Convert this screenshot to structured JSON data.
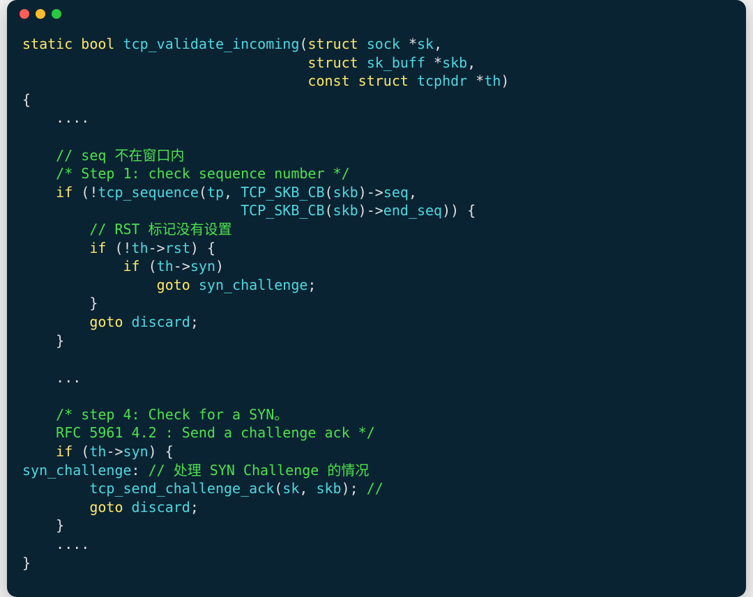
{
  "colors": {
    "background": "#0a2332",
    "keyword": "#ffe86b",
    "identifier": "#4fd8e0",
    "comment": "#4ee04e",
    "punct": "#e0e0e0",
    "traffic_red": "#ff5e57",
    "traffic_yellow": "#febc2e",
    "traffic_green": "#28c840"
  },
  "titlebar": {
    "buttons": [
      "close",
      "minimize",
      "zoom"
    ]
  },
  "code": {
    "lines": [
      [
        [
          "kw",
          "static"
        ],
        [
          "pn",
          " "
        ],
        [
          "kw",
          "bool"
        ],
        [
          "pn",
          " "
        ],
        [
          "fn",
          "tcp_validate_incoming"
        ],
        [
          "pn",
          "("
        ],
        [
          "kw",
          "struct"
        ],
        [
          "pn",
          " "
        ],
        [
          "fn",
          "sock"
        ],
        [
          "pn",
          " *"
        ],
        [
          "fn",
          "sk"
        ],
        [
          "pn",
          ","
        ]
      ],
      [
        [
          "pn",
          "                                  "
        ],
        [
          "kw",
          "struct"
        ],
        [
          "pn",
          " "
        ],
        [
          "fn",
          "sk_buff"
        ],
        [
          "pn",
          " *"
        ],
        [
          "fn",
          "skb"
        ],
        [
          "pn",
          ","
        ]
      ],
      [
        [
          "pn",
          "                                  "
        ],
        [
          "kw",
          "const"
        ],
        [
          "pn",
          " "
        ],
        [
          "kw",
          "struct"
        ],
        [
          "pn",
          " "
        ],
        [
          "fn",
          "tcphdr"
        ],
        [
          "pn",
          " *"
        ],
        [
          "fn",
          "th"
        ],
        [
          "pn",
          ")"
        ]
      ],
      [
        [
          "pn",
          "{"
        ]
      ],
      [
        [
          "pn",
          "    ...."
        ]
      ],
      [
        [
          "pn",
          ""
        ]
      ],
      [
        [
          "pn",
          "    "
        ],
        [
          "cm",
          "// seq 不在窗口内"
        ]
      ],
      [
        [
          "pn",
          "    "
        ],
        [
          "cm",
          "/* Step 1: check sequence number */"
        ]
      ],
      [
        [
          "pn",
          "    "
        ],
        [
          "kw",
          "if"
        ],
        [
          "pn",
          " (!"
        ],
        [
          "fn",
          "tcp_sequence"
        ],
        [
          "pn",
          "("
        ],
        [
          "fn",
          "tp"
        ],
        [
          "pn",
          ", "
        ],
        [
          "fn",
          "TCP_SKB_CB"
        ],
        [
          "pn",
          "("
        ],
        [
          "fn",
          "skb"
        ],
        [
          "pn",
          ")->"
        ],
        [
          "fn",
          "seq"
        ],
        [
          "pn",
          ","
        ]
      ],
      [
        [
          "pn",
          "                          "
        ],
        [
          "fn",
          "TCP_SKB_CB"
        ],
        [
          "pn",
          "("
        ],
        [
          "fn",
          "skb"
        ],
        [
          "pn",
          ")->"
        ],
        [
          "fn",
          "end_seq"
        ],
        [
          "pn",
          ")) {"
        ]
      ],
      [
        [
          "pn",
          "        "
        ],
        [
          "cm",
          "// RST 标记没有设置"
        ]
      ],
      [
        [
          "pn",
          "        "
        ],
        [
          "kw",
          "if"
        ],
        [
          "pn",
          " (!"
        ],
        [
          "fn",
          "th"
        ],
        [
          "pn",
          "->"
        ],
        [
          "fn",
          "rst"
        ],
        [
          "pn",
          ") {"
        ]
      ],
      [
        [
          "pn",
          "            "
        ],
        [
          "kw",
          "if"
        ],
        [
          "pn",
          " ("
        ],
        [
          "fn",
          "th"
        ],
        [
          "pn",
          "->"
        ],
        [
          "fn",
          "syn"
        ],
        [
          "pn",
          ")"
        ]
      ],
      [
        [
          "pn",
          "                "
        ],
        [
          "kw",
          "goto"
        ],
        [
          "pn",
          " "
        ],
        [
          "fn",
          "syn_challenge"
        ],
        [
          "pn",
          ";"
        ]
      ],
      [
        [
          "pn",
          "        }"
        ]
      ],
      [
        [
          "pn",
          "        "
        ],
        [
          "kw",
          "goto"
        ],
        [
          "pn",
          " "
        ],
        [
          "fn",
          "discard"
        ],
        [
          "pn",
          ";"
        ]
      ],
      [
        [
          "pn",
          "    }"
        ]
      ],
      [
        [
          "pn",
          ""
        ]
      ],
      [
        [
          "pn",
          "    ..."
        ]
      ],
      [
        [
          "pn",
          ""
        ]
      ],
      [
        [
          "pn",
          "    "
        ],
        [
          "cm",
          "/* step 4: Check for a SYN。"
        ]
      ],
      [
        [
          "pn",
          "    "
        ],
        [
          "cm",
          "RFC 5961 4.2 : Send a challenge ack */"
        ]
      ],
      [
        [
          "pn",
          "    "
        ],
        [
          "kw",
          "if"
        ],
        [
          "pn",
          " ("
        ],
        [
          "fn",
          "th"
        ],
        [
          "pn",
          "->"
        ],
        [
          "fn",
          "syn"
        ],
        [
          "pn",
          ") {"
        ]
      ],
      [
        [
          "fn",
          "syn_challenge"
        ],
        [
          "pn",
          ": "
        ],
        [
          "cm",
          "// 处理 SYN Challenge 的情况"
        ]
      ],
      [
        [
          "pn",
          "        "
        ],
        [
          "fn",
          "tcp_send_challenge_ack"
        ],
        [
          "pn",
          "("
        ],
        [
          "fn",
          "sk"
        ],
        [
          "pn",
          ", "
        ],
        [
          "fn",
          "skb"
        ],
        [
          "pn",
          "); "
        ],
        [
          "cm",
          "//"
        ]
      ],
      [
        [
          "pn",
          "        "
        ],
        [
          "kw",
          "goto"
        ],
        [
          "pn",
          " "
        ],
        [
          "fn",
          "discard"
        ],
        [
          "pn",
          ";"
        ]
      ],
      [
        [
          "pn",
          "    }"
        ]
      ],
      [
        [
          "pn",
          "    ...."
        ]
      ],
      [
        [
          "pn",
          "}"
        ]
      ]
    ]
  }
}
